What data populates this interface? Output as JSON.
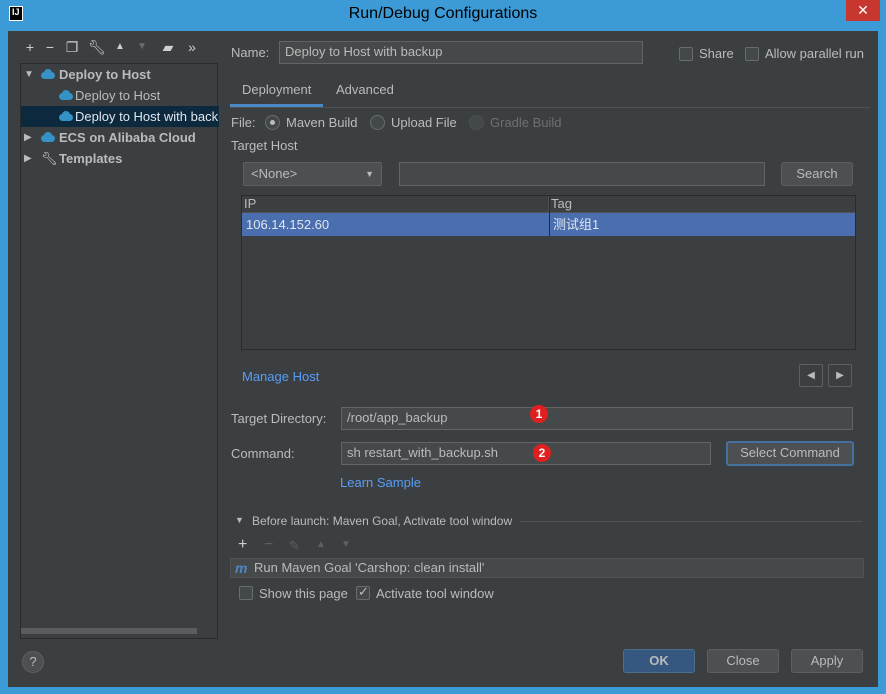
{
  "window": {
    "title": "Run/Debug Configurations",
    "app_icon": "IJ",
    "close_glyph": "✕"
  },
  "left_toolbar": {
    "icons": [
      "plus-icon",
      "minus-icon",
      "copy-icon",
      "wrench-icon",
      "arrow-up-icon",
      "arrow-down-icon",
      "folder-icon",
      "more-icon"
    ]
  },
  "tree": {
    "items": [
      {
        "label": "Deploy to Host",
        "icon": "cloud-icon",
        "bold": true,
        "expanded": true
      },
      {
        "label": "Deploy to Host",
        "icon": "cloud-icon",
        "bold": false
      },
      {
        "label": "Deploy to Host with backup",
        "icon": "cloud-icon",
        "bold": false,
        "selected": true
      },
      {
        "label": "ECS on Alibaba Cloud",
        "icon": "cloud-icon",
        "bold": true,
        "expanded": false
      },
      {
        "label": "Templates",
        "icon": "wrench-icon",
        "bold": true,
        "expanded": false
      }
    ]
  },
  "header": {
    "name_label": "Name:",
    "name_value": "Deploy to Host with backup",
    "share_label": "Share",
    "share_checked": false,
    "parallel_label": "Allow parallel run",
    "parallel_checked": false
  },
  "tabs": [
    {
      "label": "Deployment",
      "active": true
    },
    {
      "label": "Advanced",
      "active": false
    }
  ],
  "deployment": {
    "file_label": "File:",
    "file_options": [
      {
        "label": "Maven Build",
        "selected": true,
        "enabled": true
      },
      {
        "label": "Upload File",
        "selected": false,
        "enabled": true
      },
      {
        "label": "Gradle Build",
        "selected": false,
        "enabled": false
      }
    ],
    "target_host_label": "Target Host",
    "group_select": "<None>",
    "search_value": "",
    "search_button": "Search",
    "table": {
      "columns": [
        "IP",
        "Tag"
      ],
      "rows": [
        {
          "ip": "106.14.152.60",
          "tag": "测试组1",
          "selected": true
        }
      ]
    },
    "manage_host_link": "Manage Host",
    "prev_glyph": "◀",
    "next_glyph": "▶",
    "target_dir_label": "Target Directory:",
    "target_dir_value": "/root/app_backup",
    "badge1": "1",
    "command_label": "Command:",
    "command_value": "sh restart_with_backup.sh",
    "badge2": "2",
    "select_command_button": "Select Command",
    "learn_sample_link": "Learn Sample"
  },
  "before_launch": {
    "header": "Before launch: Maven Goal, Activate tool window",
    "toolbar_icons": [
      "plus-icon",
      "minus-icon",
      "pencil-icon",
      "arrow-up-icon",
      "arrow-down-icon"
    ],
    "task_icon": "m",
    "task_label": "Run Maven Goal 'Carshop: clean install'",
    "show_page_label": "Show this page",
    "show_page_checked": false,
    "activate_label": "Activate tool window",
    "activate_checked": true
  },
  "footer": {
    "help": "?",
    "ok": "OK",
    "close": "Close",
    "apply": "Apply"
  }
}
